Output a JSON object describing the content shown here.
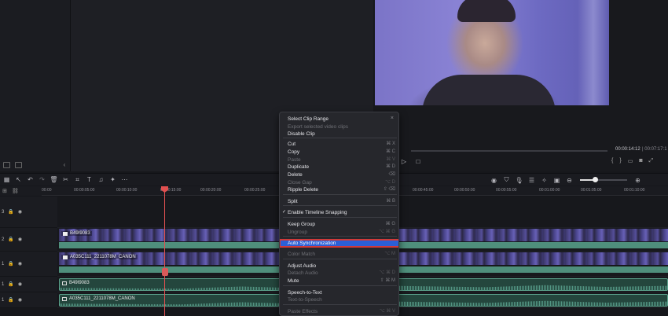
{
  "preview": {
    "current_time": "00:00:14:12",
    "total_time": "| 00:07:17:1"
  },
  "ruler": {
    "ticks": [
      "00:00",
      "00:00:05:00",
      "00:00:10:00",
      "00:00:15:00",
      "00:00:20:00",
      "00:00:25:00",
      "00:00:30:00",
      "00:00:35:00",
      "00:00:40:00",
      "00:00:45:00",
      "00:00:50:00",
      "00:00:55:00",
      "00:01:00:00",
      "00:01:05:00",
      "00:01:10:00"
    ]
  },
  "tracks": {
    "video3_num": "3",
    "video2_num": "2",
    "video1_num": "1",
    "audio1_num": "1",
    "audio2_num": "1"
  },
  "clips": {
    "video_top": "B49I9083",
    "video_bottom": "A035C111_2211078M_CANON",
    "audio_top": "B49I9083",
    "audio_bottom": "A035C111_2211078M_CANON"
  },
  "context_menu": {
    "close_icon": "×",
    "items": [
      {
        "label": "Select Clip Range",
        "shortcut": "",
        "enabled": true
      },
      {
        "label": "Export selected video clips",
        "shortcut": "",
        "enabled": false
      },
      {
        "label": "Disable Clip",
        "shortcut": "",
        "enabled": true
      },
      {
        "label": "Cut",
        "shortcut": "⌘ X",
        "enabled": true
      },
      {
        "label": "Copy",
        "shortcut": "⌘ C",
        "enabled": true
      },
      {
        "label": "Paste",
        "shortcut": "⌘ V",
        "enabled": false
      },
      {
        "label": "Duplicate",
        "shortcut": "⌘ D",
        "enabled": true
      },
      {
        "label": "Delete",
        "shortcut": "⌫",
        "enabled": true
      },
      {
        "label": "Close Gap",
        "shortcut": "⌥ D",
        "enabled": false
      },
      {
        "label": "Ripple Delete",
        "shortcut": "⇧ ⌫",
        "enabled": true
      },
      {
        "label": "Split",
        "shortcut": "⌘ B",
        "enabled": true
      },
      {
        "label": "Enable Timeline Snapping",
        "shortcut": "",
        "enabled": true,
        "checked": true
      },
      {
        "label": "Keep Group",
        "shortcut": "⌘ G",
        "enabled": true
      },
      {
        "label": "Ungroup",
        "shortcut": "⌥ ⌘ G",
        "enabled": false
      },
      {
        "label": "Auto Synchronization",
        "shortcut": "",
        "enabled": true,
        "highlighted": true
      },
      {
        "label": "Color Match",
        "shortcut": "⌥ M",
        "enabled": false
      },
      {
        "label": "Adjust Audio",
        "shortcut": "",
        "enabled": true
      },
      {
        "label": "Detach Audio",
        "shortcut": "⌥ ⌘ D",
        "enabled": false
      },
      {
        "label": "Mute",
        "shortcut": "⇧ ⌘ M",
        "enabled": true
      },
      {
        "label": "Speech-to-Text",
        "shortcut": "",
        "enabled": true
      },
      {
        "label": "Text-to-Speech",
        "shortcut": "",
        "enabled": false
      },
      {
        "label": "Paste Effects",
        "shortcut": "⌥ ⌘ V",
        "enabled": false
      }
    ]
  }
}
